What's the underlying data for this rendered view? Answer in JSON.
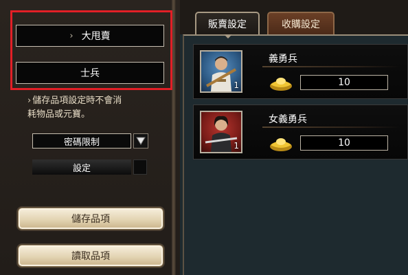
{
  "left": {
    "categories": [
      {
        "label": "大甩賣",
        "chevron": "›"
      },
      {
        "label": "士兵"
      }
    ],
    "note_line1": "儲存品項設定時不會消",
    "note_line2": "耗物品或元寶。",
    "note_arrow": "›",
    "password_select": "密碼限制",
    "set_label": "設定",
    "save_button": "儲存品項",
    "load_button": "讀取品項"
  },
  "tabs": {
    "sell": "販賣設定",
    "buy": "收購設定"
  },
  "units": [
    {
      "name": "義勇兵",
      "count": "1",
      "price": "10",
      "icon": "gold-ingot-icon"
    },
    {
      "name": "女義勇兵",
      "count": "1",
      "price": "10",
      "icon": "gold-ingot-icon"
    }
  ],
  "colors": {
    "highlight": "#e21f26",
    "tab_inactive": "#6a3f26",
    "button_face": "#e3d4b3"
  }
}
